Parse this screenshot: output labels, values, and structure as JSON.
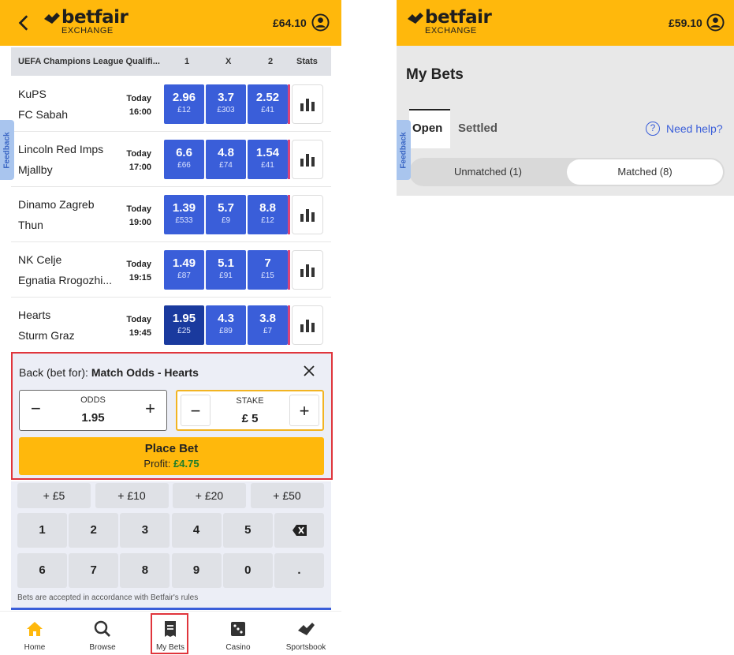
{
  "left": {
    "balance": "£64.10",
    "logo_word": "betfair",
    "logo_sub": "EXCHANGE",
    "columns": {
      "competition": "UEFA Champions League Qualifi...",
      "c1": "1",
      "cx": "X",
      "c2": "2",
      "stats": "Stats"
    },
    "events": [
      {
        "home": "KuPS",
        "away": "FC Sabah",
        "day": "Today",
        "time": "16:00",
        "odds": [
          {
            "price": "2.96",
            "size": "£12"
          },
          {
            "price": "3.7",
            "size": "£303"
          },
          {
            "price": "2.52",
            "size": "£41"
          }
        ]
      },
      {
        "home": "Lincoln Red Imps",
        "away": "Mjallby",
        "day": "Today",
        "time": "17:00",
        "odds": [
          {
            "price": "6.6",
            "size": "£66"
          },
          {
            "price": "4.8",
            "size": "£74"
          },
          {
            "price": "1.54",
            "size": "£41"
          }
        ]
      },
      {
        "home": "Dinamo Zagreb",
        "away": "Thun",
        "day": "Today",
        "time": "19:00",
        "odds": [
          {
            "price": "1.39",
            "size": "£533"
          },
          {
            "price": "5.7",
            "size": "£9"
          },
          {
            "price": "8.8",
            "size": "£12"
          }
        ]
      },
      {
        "home": "NK Celje",
        "away": "Egnatia Rrogozhi...",
        "day": "Today",
        "time": "19:15",
        "odds": [
          {
            "price": "1.49",
            "size": "£87"
          },
          {
            "price": "5.1",
            "size": "£91"
          },
          {
            "price": "7",
            "size": "£15"
          }
        ]
      },
      {
        "home": "Hearts",
        "away": "Sturm Graz",
        "day": "Today",
        "time": "19:45",
        "odds": [
          {
            "price": "1.95",
            "size": "£25"
          },
          {
            "price": "4.3",
            "size": "£89"
          },
          {
            "price": "3.8",
            "size": "£7"
          }
        ]
      }
    ],
    "feedback": "Feedback",
    "betslip": {
      "prefix": "Back (bet for):",
      "market": "Match Odds - Hearts",
      "odds_label": "ODDS",
      "odds_value": "1.95",
      "stake_label": "STAKE",
      "stake_value": "£ 5",
      "place_label": "Place Bet",
      "profit_label": "Profit:",
      "profit_value": "£4.75"
    },
    "quick_stakes": [
      "+ £5",
      "+ £10",
      "+ £20",
      "+ £50"
    ],
    "keys_row1": [
      "1",
      "2",
      "3",
      "4",
      "5"
    ],
    "keys_row2": [
      "6",
      "7",
      "8",
      "9",
      "0",
      "."
    ],
    "rules": "Bets are accepted in accordance with Betfair's rules",
    "nav": [
      {
        "label": "Home",
        "icon": "home-icon"
      },
      {
        "label": "Browse",
        "icon": "search-icon"
      },
      {
        "label": "My Bets",
        "icon": "bet-slip-icon"
      },
      {
        "label": "Casino",
        "icon": "dice-icon"
      },
      {
        "label": "Sportsbook",
        "icon": "sportsbook-icon"
      }
    ]
  },
  "right": {
    "balance": "£59.10",
    "logo_word": "betfair",
    "logo_sub": "EXCHANGE",
    "title": "My Bets",
    "tab_open": "Open",
    "tab_settled": "Settled",
    "help": "Need help?",
    "feedback": "Feedback",
    "seg_unmatched": "Unmatched (1)",
    "seg_matched": "Matched (8)"
  },
  "colors": {
    "brand": "#ffb80c",
    "odds_blue": "#3a5ed9",
    "selected_blue": "#1a3a9e",
    "profit_green": "#1c7d2a",
    "highlight_red": "#e0353c"
  }
}
